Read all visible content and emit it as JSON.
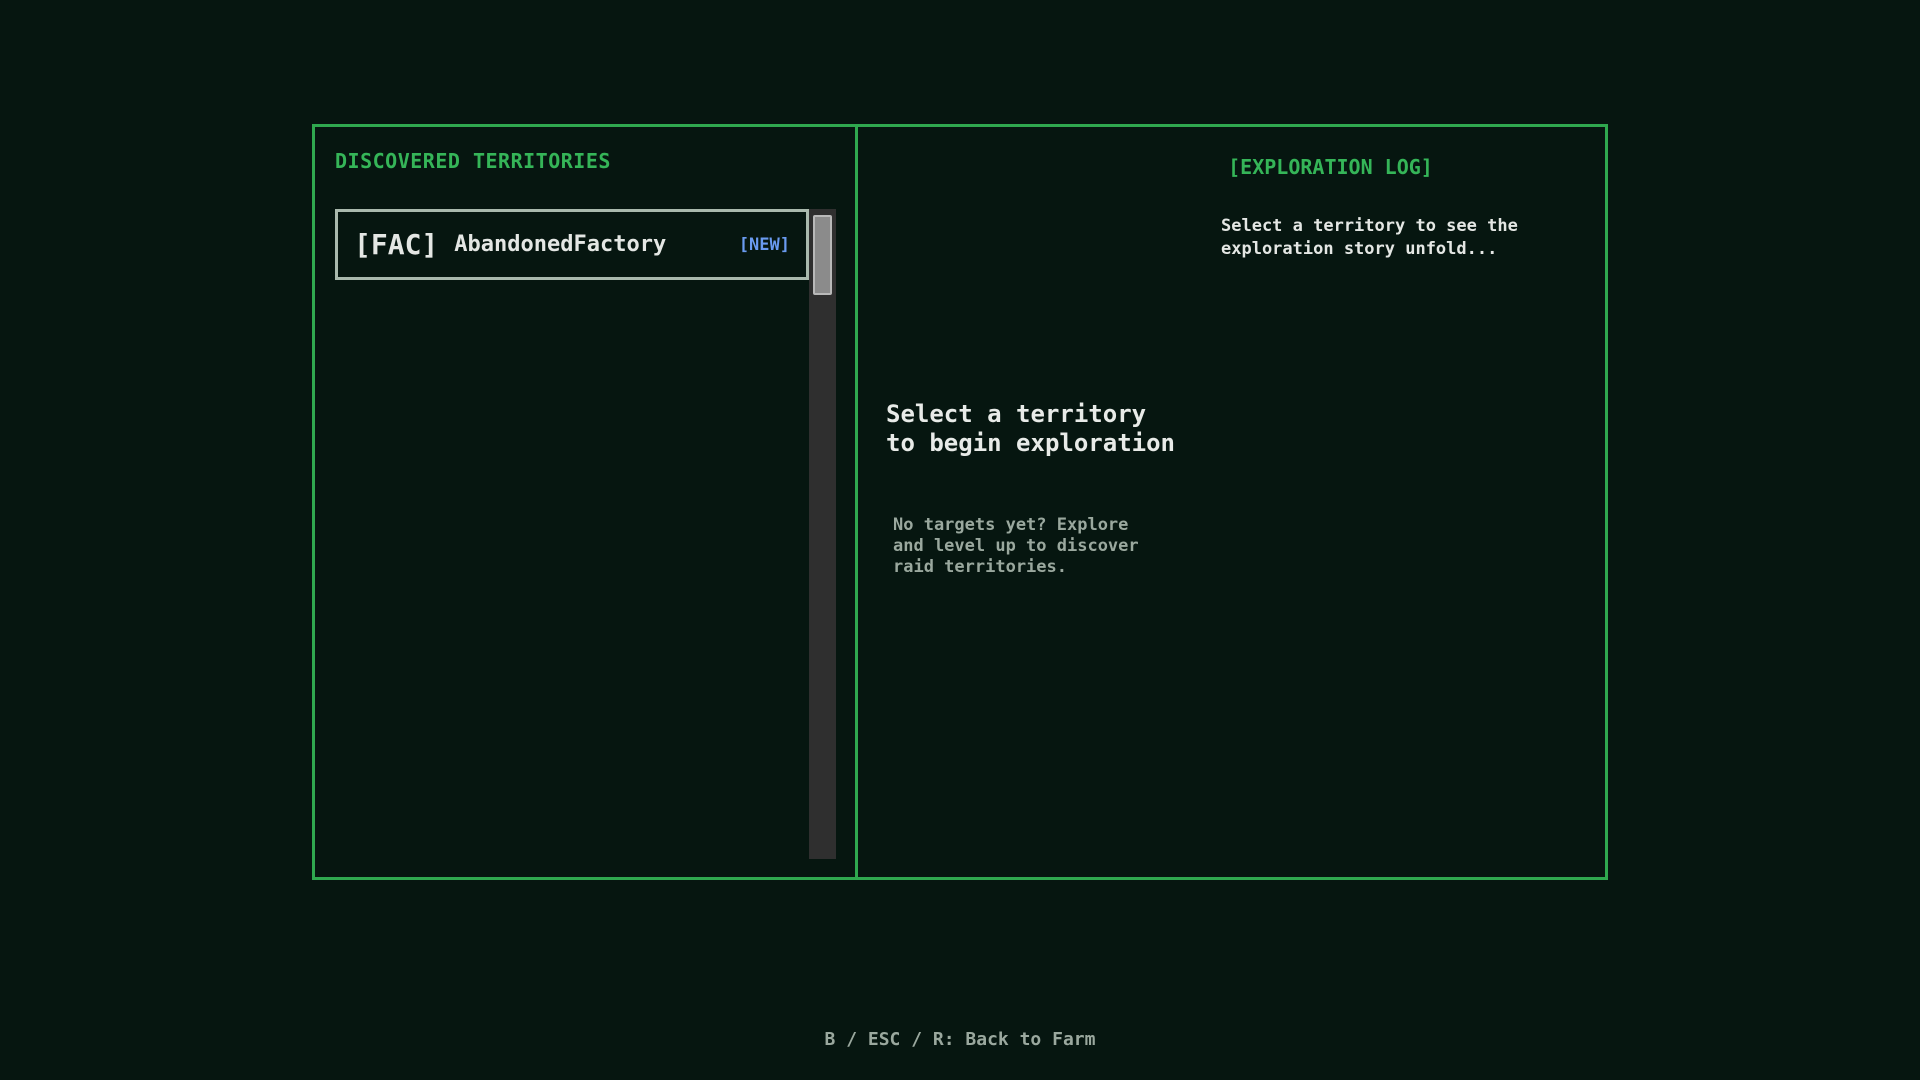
{
  "left_panel": {
    "title": "DISCOVERED TERRITORIES",
    "territories": [
      {
        "tag": "[FAC]",
        "name": "AbandonedFactory",
        "badge": "[NEW]"
      }
    ]
  },
  "center": {
    "prompt_title": "Select a territory to begin exploration",
    "prompt_hint": "No targets yet? Explore and level up to discover raid territories."
  },
  "exploration_log": {
    "title": "[EXPLORATION LOG]",
    "text": "Select a territory to see the exploration story unfold..."
  },
  "footer": {
    "hint": "B / ESC / R: Back to Farm"
  },
  "colors": {
    "background": "#061610",
    "frame": "#2fa84f",
    "heading": "#35b558",
    "badge": "#6a9bf0"
  }
}
